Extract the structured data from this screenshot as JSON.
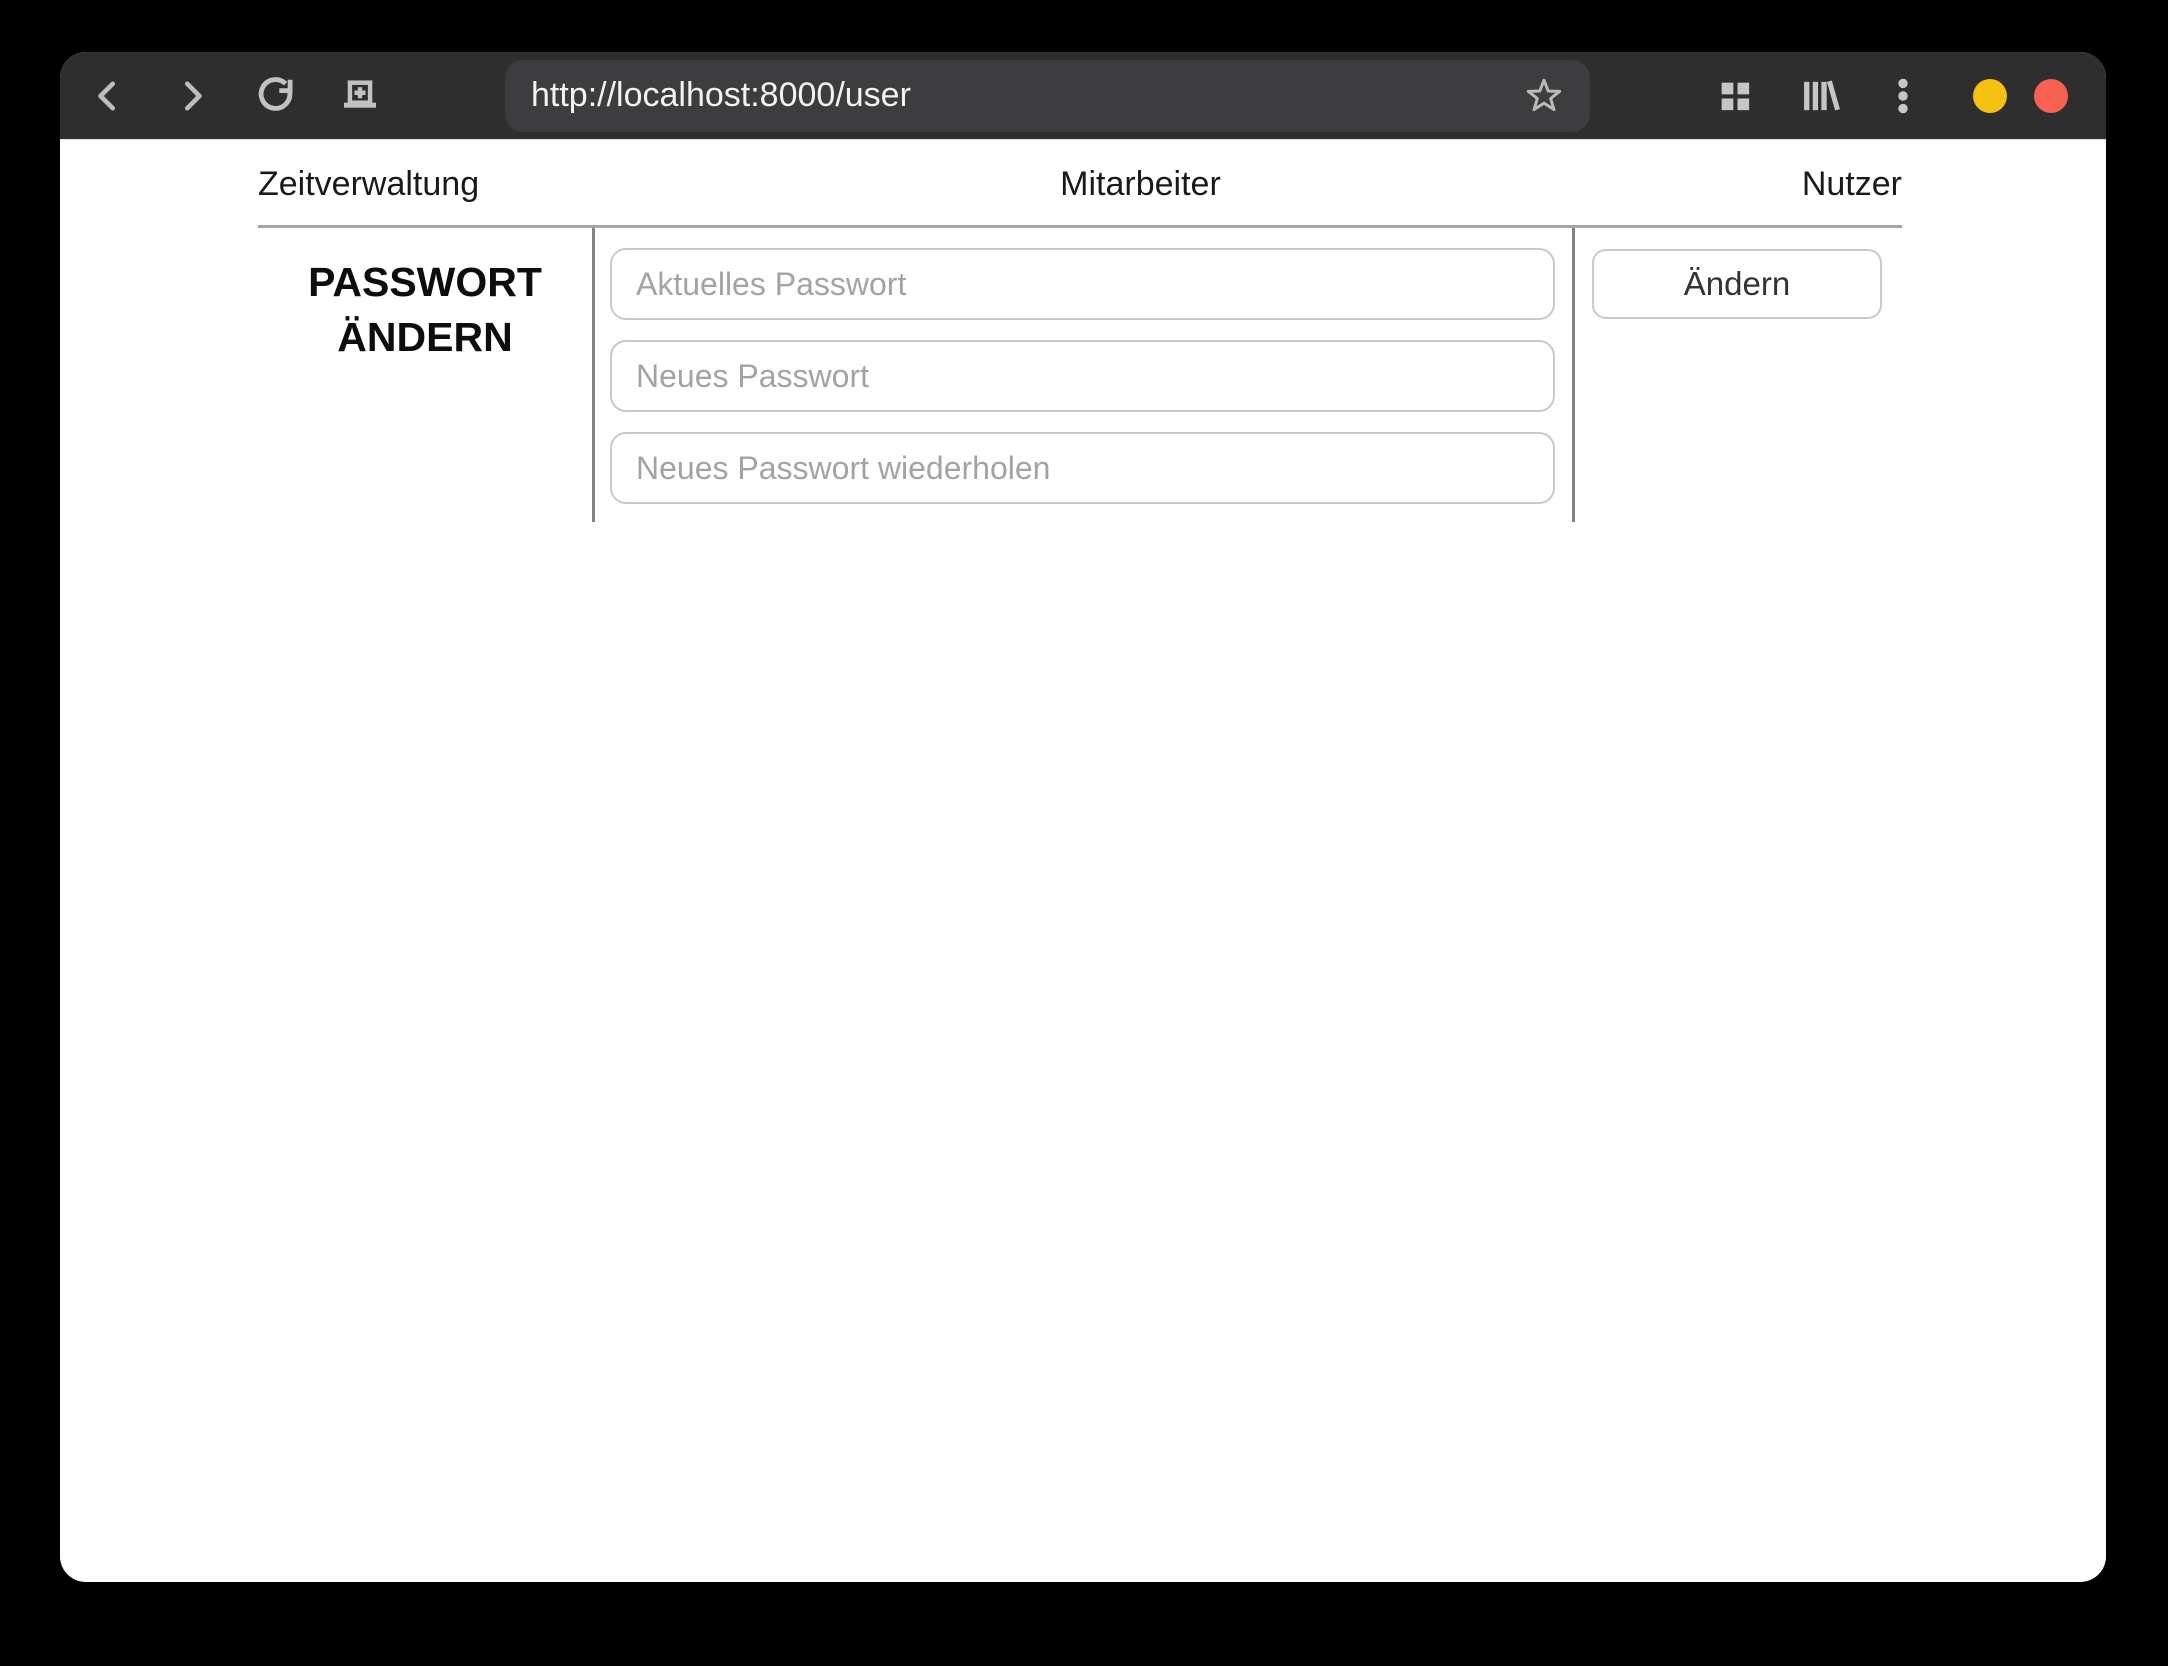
{
  "browser": {
    "url": "http://localhost:8000/user",
    "toolbar_icons": {
      "back": "chevron-left",
      "forward": "chevron-right",
      "reload": "refresh-arrow",
      "new_tab": "tab-with-plus",
      "bookmark": "star-outline",
      "tab_overview": "grid-2x2",
      "library": "books-on-shelf",
      "menu": "kebab-vertical-dots"
    },
    "window_controls": {
      "minimize_color": "#f5c211",
      "close_color": "#f66151"
    },
    "colors": {
      "toolbar_bg": "#2e2e2e",
      "urlbar_bg": "#3d3d40"
    }
  },
  "nav": {
    "items": [
      {
        "label": "Zeitverwaltung"
      },
      {
        "label": "Mitarbeiter"
      },
      {
        "label": "Nutzer"
      }
    ]
  },
  "password_form": {
    "title": "PASSWORT ÄNDERN",
    "fields": [
      {
        "placeholder": "Aktuelles Passwort"
      },
      {
        "placeholder": "Neues Passwort"
      },
      {
        "placeholder": "Neues Passwort wiederholen"
      }
    ],
    "submit_label": "Ändern"
  }
}
